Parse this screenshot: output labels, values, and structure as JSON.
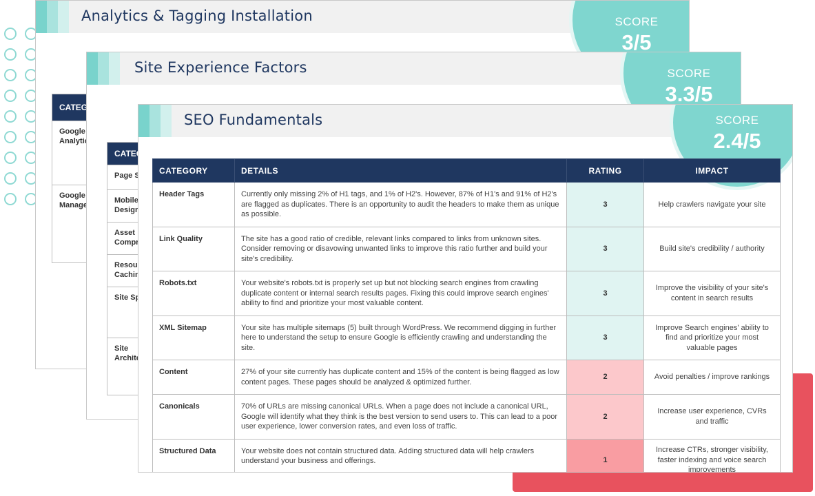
{
  "cards": {
    "back": {
      "title": "Analytics & Tagging Installation",
      "score_label": "SCORE",
      "score_value": "3/5",
      "table_header": "CATEGO",
      "rows": [
        {
          "label": "Google\nAnalytic"
        },
        {
          "label": "Google\nManage"
        }
      ]
    },
    "middle": {
      "title": "Site Experience Factors",
      "score_label": "SCORE",
      "score_value": "3.3/5",
      "table_header": "CATEG",
      "rows": [
        {
          "label": "Page S"
        },
        {
          "label": "Mobile\nDesign"
        },
        {
          "label": "Asset\nCompr"
        },
        {
          "label": "Resour\nCachin"
        },
        {
          "label": "Site Sp"
        },
        {
          "label": "Site\nArchite"
        }
      ]
    },
    "front": {
      "title": "SEO Fundamentals",
      "score_label": "SCORE",
      "score_value": "2.4/5",
      "columns": [
        "CATEGORY",
        "DETAILS",
        "RATING",
        "IMPACT"
      ],
      "rows": [
        {
          "category": "Header Tags",
          "details": "Currently only missing 2% of H1 tags, and 1% of H2's. However, 87% of H1's and 91% of H2's are flagged as duplicates. There is an opportunity to audit the headers to make them as unique as possible.",
          "rating": "3",
          "impact": "Help crawlers navigate your site",
          "level": "green"
        },
        {
          "category": "Link Quality",
          "details": "The site has a good ratio of credible, relevant links compared to links from unknown sites. Consider removing or disavowing unwanted links to improve this ratio further and build your site's credibility.",
          "rating": "3",
          "impact": "Build site's credibility / authority",
          "level": "green"
        },
        {
          "category": "Robots.txt",
          "details": "Your website's robots.txt is properly set up but not blocking search engines from crawling duplicate content or internal search results pages. Fixing this could improve search engines' ability to find and prioritize your most valuable content.",
          "rating": "3",
          "impact": "Improve the visibility of your site's content in search results",
          "level": "green"
        },
        {
          "category": "XML Sitemap",
          "details": "Your site has multiple sitemaps (5) built through WordPress. We recommend digging in further here to understand the setup to ensure Google is efficiently crawling and understanding the site.",
          "rating": "3",
          "impact": "Improve Search engines' ability to find and prioritize your most valuable pages",
          "level": "green"
        },
        {
          "category": "Content",
          "details": "27% of your site currently has duplicate content and 15% of the content is being flagged as low content pages. These pages should be analyzed & optimized further.",
          "rating": "2",
          "impact": "Avoid penalties / improve rankings",
          "level": "pink"
        },
        {
          "category": "Canonicals",
          "details": "70% of URLs are missing canonical URLs. When a page does not include a canonical URL, Google will identify what they think is the best version to send users to. This can lead to a poor user experience, lower conversion rates, and even loss of traffic.",
          "rating": "2",
          "impact": "Increase user experience, CVRs and traffic",
          "level": "pink"
        },
        {
          "category": "Structured Data",
          "details": "Your website does not contain structured data. Adding structured data will help crawlers understand your business and offerings.",
          "rating": "1",
          "impact": "Increase CTRs, stronger visibility, faster indexing and voice search improvements",
          "level": "red"
        }
      ]
    }
  },
  "colors": {
    "navy": "#1f3760",
    "teal": "#7fd6cf",
    "accent_red": "#e8525e",
    "rating_green": "#e0f4f2",
    "rating_pink": "#fcc8cb",
    "rating_red": "#f99da2"
  }
}
